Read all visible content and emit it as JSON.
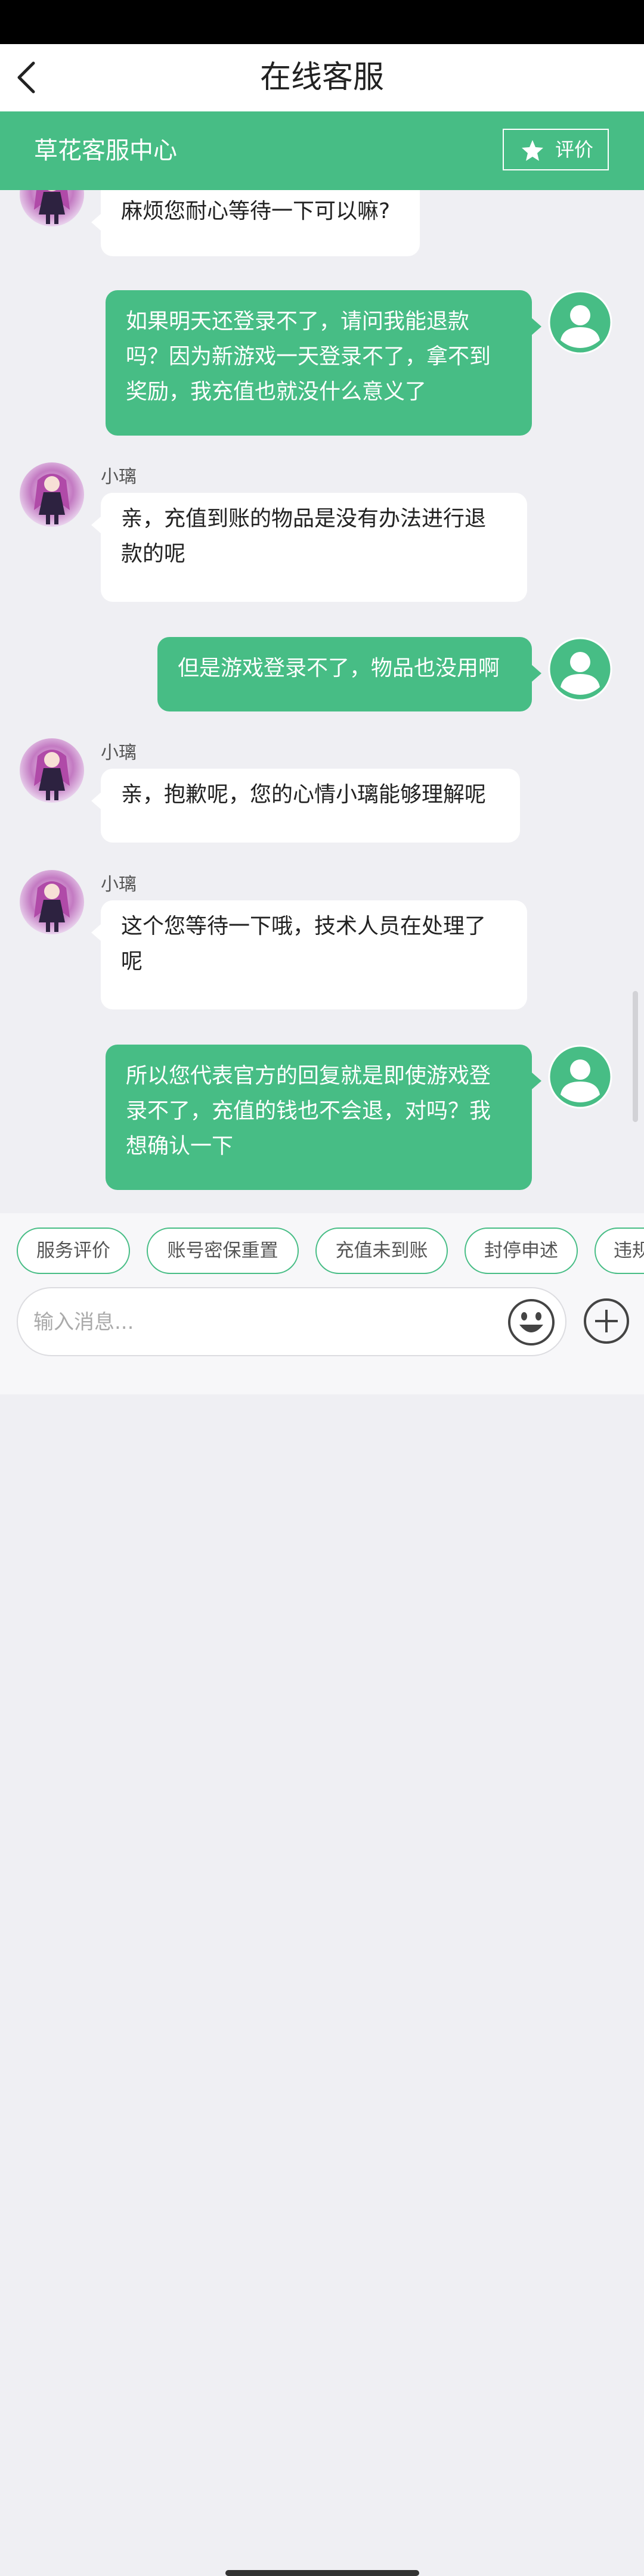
{
  "header": {
    "title": "在线客服"
  },
  "service_bar": {
    "name": "草花客服中心",
    "rate_label": "评价"
  },
  "messages": [
    {
      "from": "agent",
      "sender": "",
      "text": "麻烦您耐心等待一下可以嘛?"
    },
    {
      "from": "user",
      "text": "如果明天还登录不了，请问我能退款吗？因为新游戏一天登录不了，拿不到奖励，我充值也就没什么意义了"
    },
    {
      "from": "agent",
      "sender": "小璃",
      "text": "亲，充值到账的物品是没有办法进行退款的呢"
    },
    {
      "from": "user",
      "text": "但是游戏登录不了，物品也没用啊"
    },
    {
      "from": "agent",
      "sender": "小璃",
      "text": "亲，抱歉呢，您的心情小璃能够理解呢"
    },
    {
      "from": "agent",
      "sender": "小璃",
      "text": "这个您等待一下哦，技术人员在处理了呢"
    },
    {
      "from": "user",
      "text": "所以您代表官方的回复就是即使游戏登录不了，充值的钱也不会退，对吗？我想确认一下"
    }
  ],
  "quick_replies": [
    "服务评价",
    "账号密保重置",
    "充值未到账",
    "封停申述",
    "违规"
  ],
  "input": {
    "placeholder": "输入消息..."
  },
  "icons": {
    "back": "chevron-left-icon",
    "star": "star-icon",
    "emoji": "smiley-icon",
    "plus": "plus-circle-icon",
    "user_avatar": "user-silhouette-icon"
  },
  "colors": {
    "accent": "#47bd85",
    "background": "#efeff3"
  }
}
